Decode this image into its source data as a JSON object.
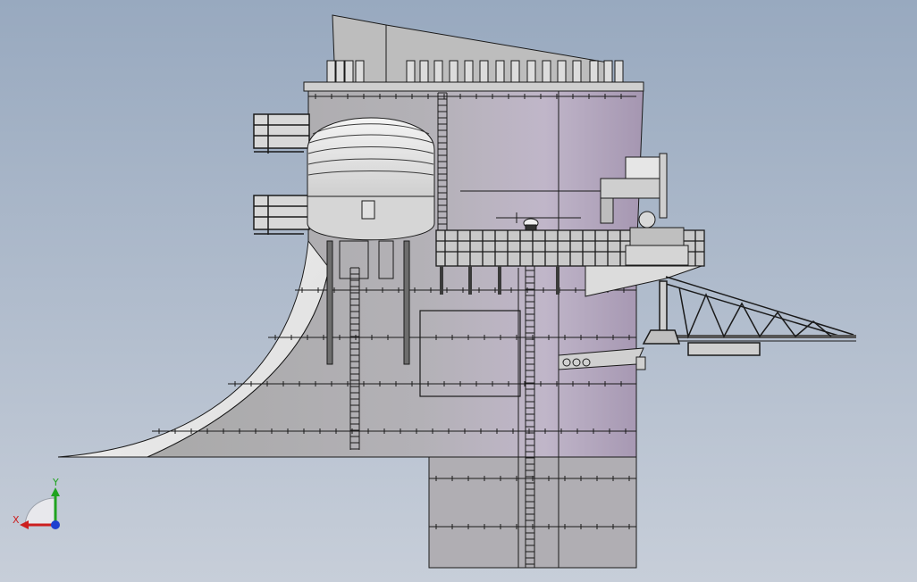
{
  "triad": {
    "x_label": "X",
    "y_label": "Y",
    "x_color": "#cc1f1f",
    "y_color": "#1fa31f",
    "z_color": "#1f3fd0"
  },
  "colors": {
    "background_top": "#98a9bf",
    "background_bottom": "#c7ced9",
    "hull_light": "#b9b9b9",
    "hull_mid": "#a7a7a7",
    "hull_dark": "#8f8f8f",
    "edge": "#1a1a1a",
    "sweep_white": "#f2f2f2",
    "shade_purple": "#b9aec4"
  }
}
